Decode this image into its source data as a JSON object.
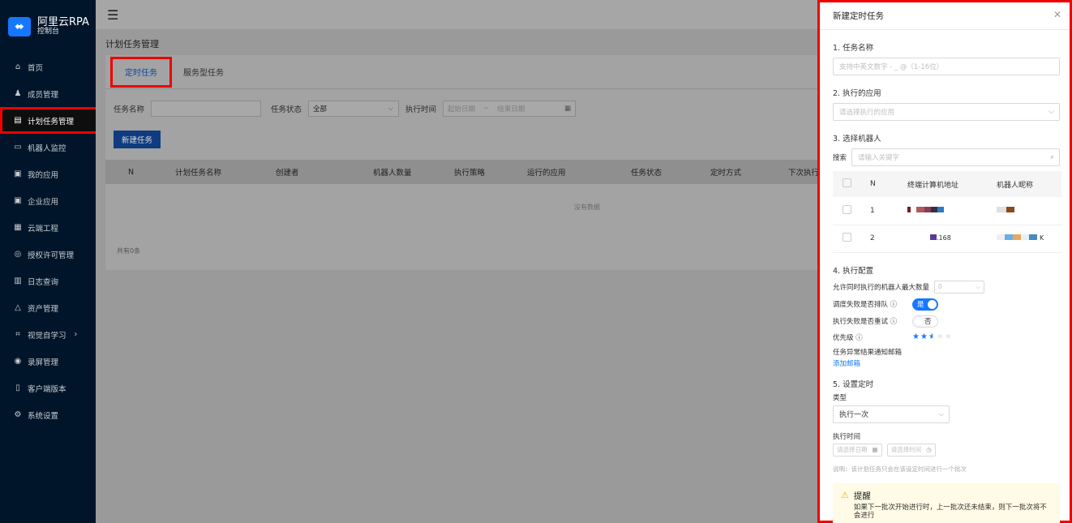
{
  "brand": {
    "name": "阿里云RPA",
    "sub": "控制台"
  },
  "sidebar": [
    {
      "icon": "⌂",
      "label": "首页"
    },
    {
      "icon": "♟",
      "label": "成员管理"
    },
    {
      "icon": "▤",
      "label": "计划任务管理",
      "active": true
    },
    {
      "icon": "▭",
      "label": "机器人监控"
    },
    {
      "icon": "▣",
      "label": "我的应用"
    },
    {
      "icon": "▣",
      "label": "企业应用"
    },
    {
      "icon": "▦",
      "label": "云端工程"
    },
    {
      "icon": "◎",
      "label": "授权许可管理"
    },
    {
      "icon": "▥",
      "label": "日志查询"
    },
    {
      "icon": "△",
      "label": "资产管理"
    },
    {
      "icon": "⌗",
      "label": "视觉自学习",
      "arrow": "›"
    },
    {
      "icon": "◉",
      "label": "录屏管理"
    },
    {
      "icon": "▯",
      "label": "客户端版本"
    },
    {
      "icon": "⚙",
      "label": "系统设置"
    }
  ],
  "topbar": {
    "menu_icon": "☰"
  },
  "page": {
    "title": "计划任务管理",
    "tabs": [
      "定时任务",
      "服务型任务"
    ],
    "filters": {
      "name_label": "任务名称",
      "status_label": "任务状态",
      "status_value": "全部",
      "time_label": "执行时间",
      "start_placeholder": "起始日期",
      "range_sep": "~",
      "end_placeholder": "结束日期"
    },
    "new_button": "新建任务",
    "columns": [
      "N",
      "计划任务名称",
      "创建者",
      "机器人数量",
      "执行策略",
      "运行的应用",
      "任务状态",
      "定时方式",
      "下次执行"
    ],
    "empty_text": "没有数据",
    "total_text": "共有0条"
  },
  "drawer": {
    "title": "新建定时任务",
    "close": "✕",
    "s1": "1. 任务名称",
    "s1_placeholder": "支持中英文数字 - _ @（1-16位）",
    "s2": "2. 执行的应用",
    "s2_placeholder": "请选择执行的应用",
    "s3": "3. 选择机器人",
    "search_label": "搜索",
    "search_placeholder": "请输入关键字",
    "robot_columns": [
      "N",
      "终端计算机地址",
      "机器人昵称"
    ],
    "robots": [
      {
        "n": "1",
        "addr": "",
        "nick": ""
      },
      {
        "n": "2",
        "addr": ".168",
        "nick": "K"
      }
    ],
    "s4": "4. 执行配置",
    "max_label": "允许同时执行的机器人最大数量",
    "max_value": "0",
    "queue_label": "调度失败是否排队 ⓘ",
    "queue_value": "是",
    "retry_label": "执行失败是否重试 ⓘ",
    "retry_value": "否",
    "priority_label": "优先级 ⓘ",
    "priority_value": 2.5,
    "notify_label": "任务异常结果通知邮箱",
    "notify_link": "添加邮箱",
    "s5": "5. 设置定时",
    "type_label": "类型",
    "type_value": "执行一次",
    "exec_time_label": "执行时间",
    "date_placeholder": "请选择日期",
    "time_placeholder": "请选择时间",
    "note": "说明：该计划任务只会在该设定时间进行一个批次",
    "alert_title": "提醒",
    "alert_text": "如果下一批次开始进行时，上一批次还未结束，则下一批次将不会进行"
  }
}
